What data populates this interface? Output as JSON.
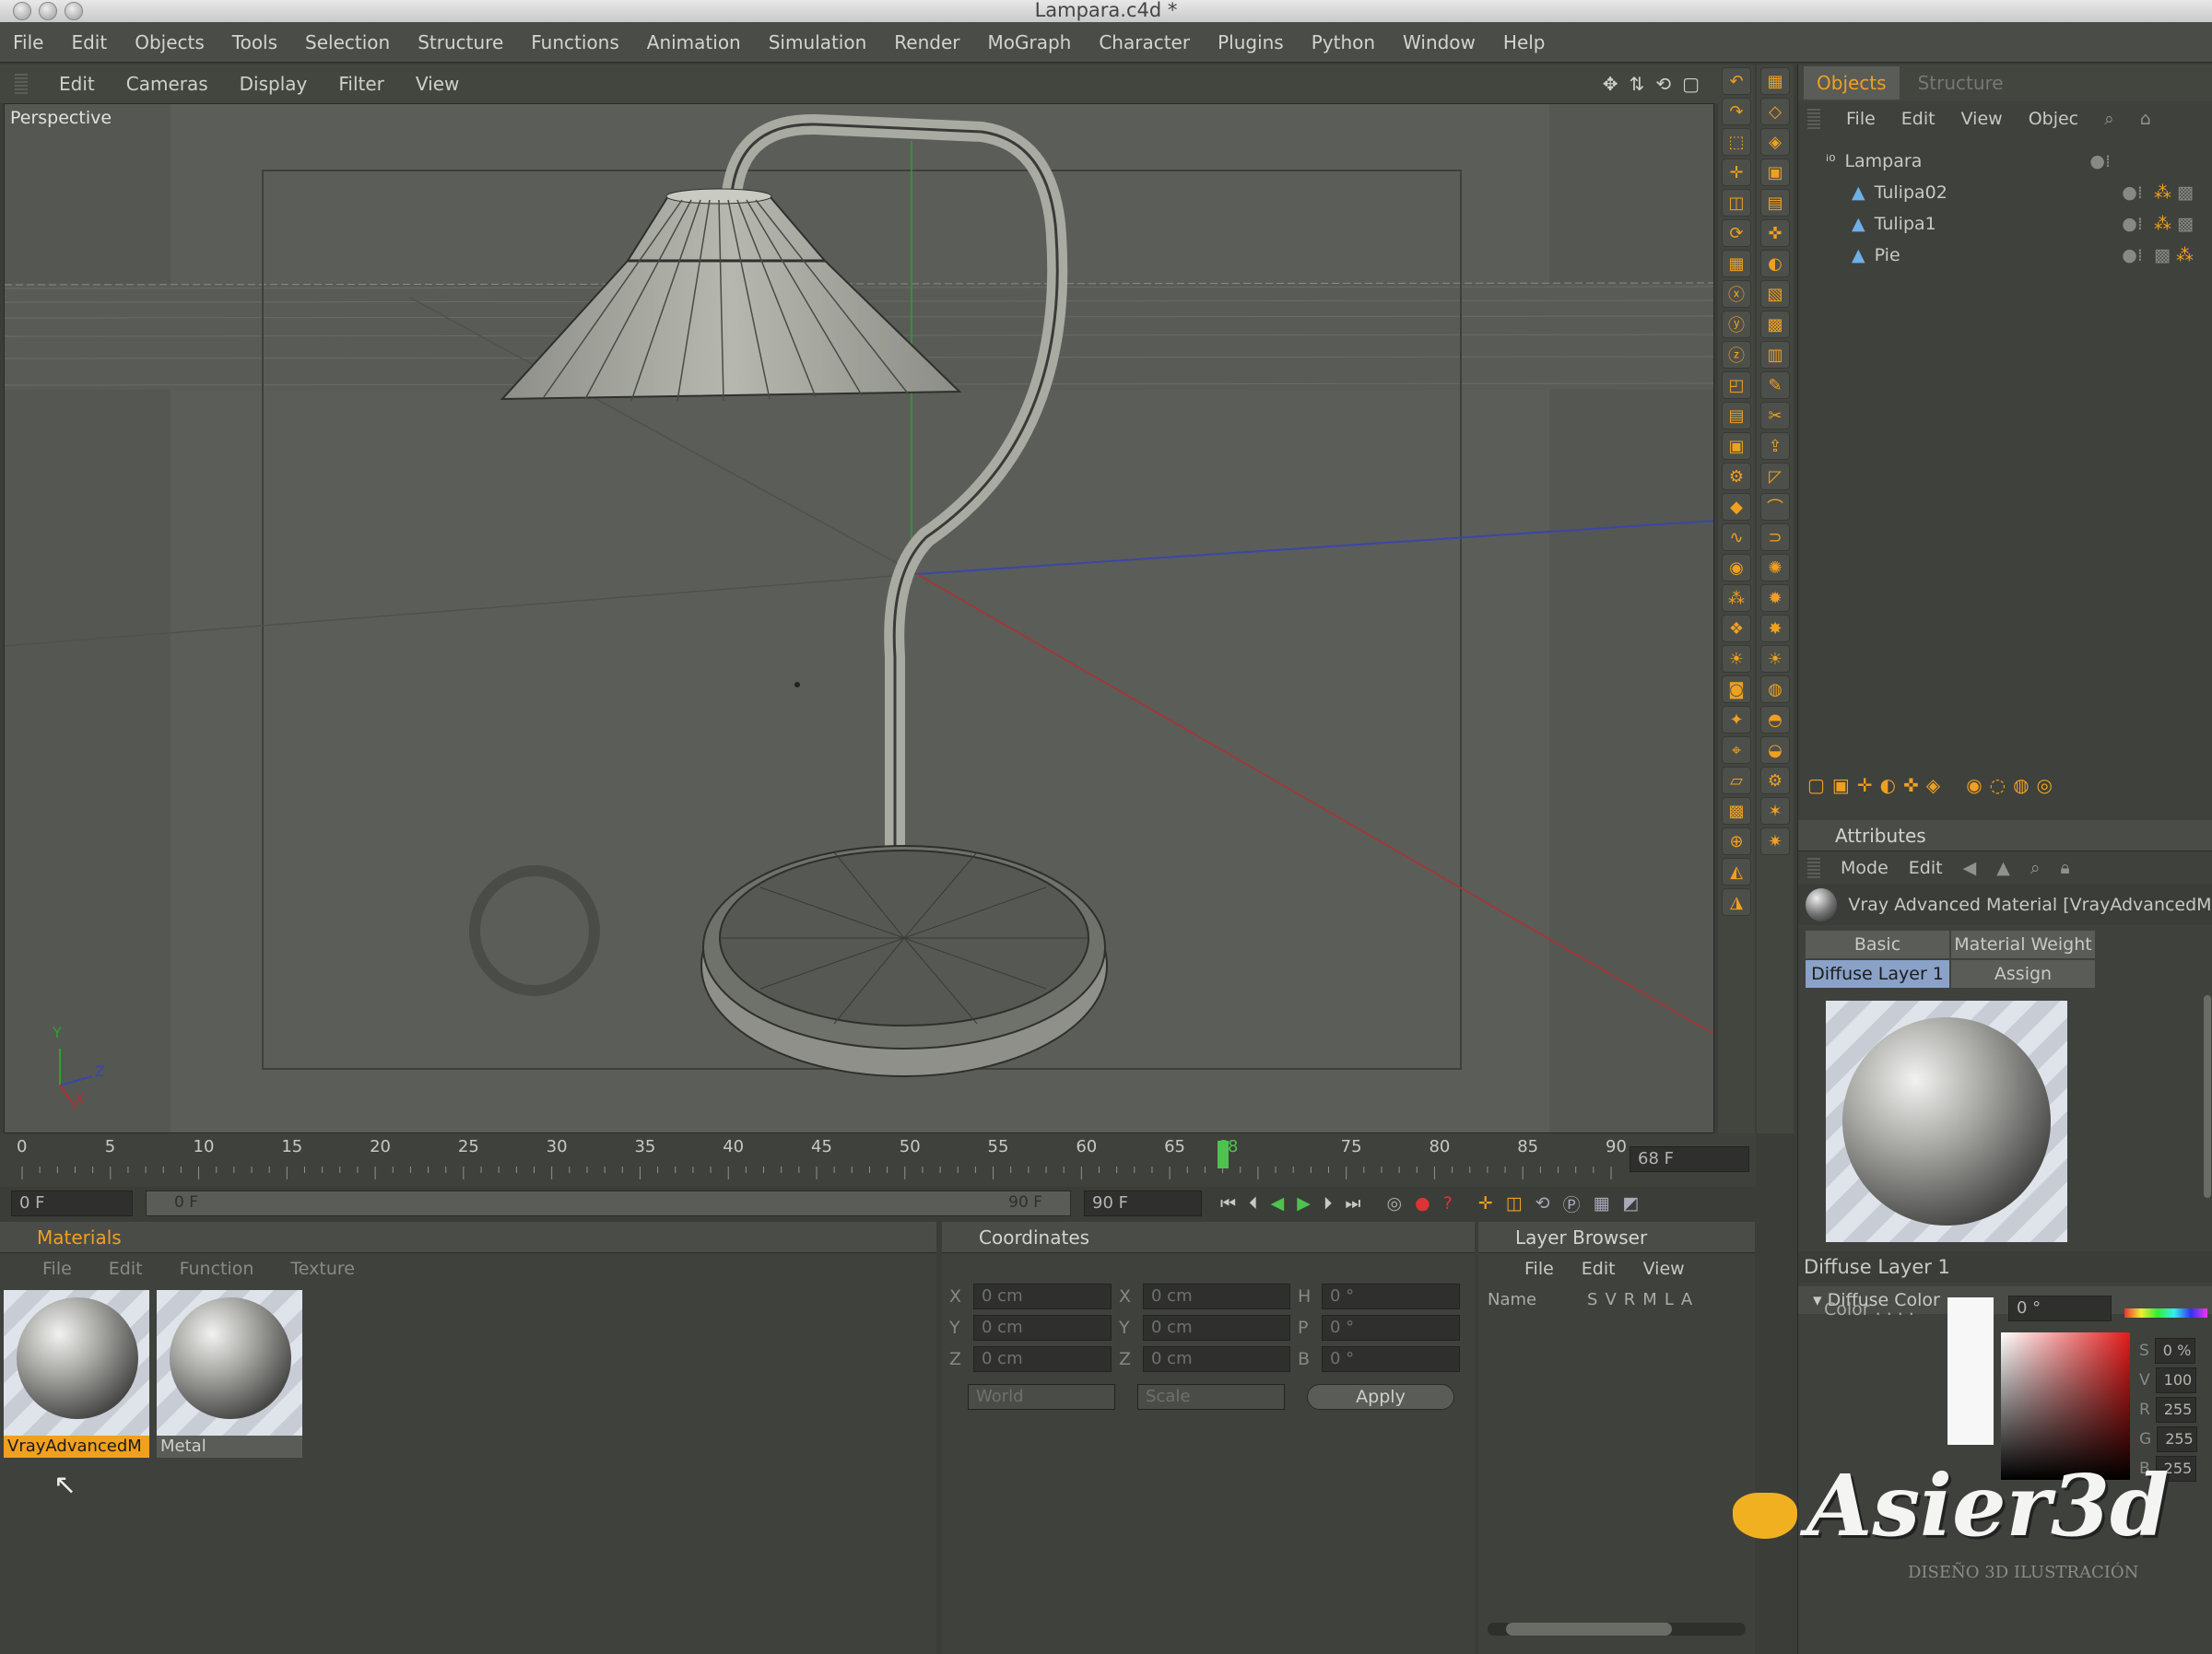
{
  "window": {
    "title": "Lampara.c4d *"
  },
  "menubar": [
    "File",
    "Edit",
    "Objects",
    "Tools",
    "Selection",
    "Structure",
    "Functions",
    "Animation",
    "Simulation",
    "Render",
    "MoGraph",
    "Character",
    "Plugins",
    "Python",
    "Window",
    "Help"
  ],
  "viewport": {
    "menu": [
      "Edit",
      "Cameras",
      "Display",
      "Filter",
      "View"
    ],
    "label": "Perspective",
    "axis": {
      "y": "Y",
      "x": "X",
      "z": "Z"
    }
  },
  "objects_panel": {
    "tabs": [
      "Objects",
      "Structure"
    ],
    "menu": [
      "File",
      "Edit",
      "View",
      "Objec"
    ],
    "tree": [
      {
        "name": "Lampara",
        "depth": 0,
        "icon": "null-object-icon"
      },
      {
        "name": "Tulipa02",
        "depth": 1,
        "icon": "polygon-object-icon"
      },
      {
        "name": "Tulipa1",
        "depth": 1,
        "icon": "polygon-object-icon"
      },
      {
        "name": "Pie",
        "depth": 1,
        "icon": "polygon-object-icon"
      }
    ]
  },
  "attributes": {
    "title": "Attributes",
    "menu": [
      "Mode",
      "Edit"
    ],
    "material_name": "Vray Advanced Material [VrayAdvancedMat",
    "tabs": [
      "Basic",
      "Material Weight",
      "Diffuse Layer 1",
      "Assign"
    ],
    "active_tab": "Diffuse Layer 1",
    "section_title": "Diffuse Layer 1",
    "group": "Diffuse Color",
    "color_label": "Color . . . .",
    "hue_value": "0 °",
    "channels": [
      {
        "label": "S",
        "value": "0 %"
      },
      {
        "label": "V",
        "value": "100"
      },
      {
        "label": "R",
        "value": "255"
      },
      {
        "label": "G",
        "value": "255"
      },
      {
        "label": "B",
        "value": "255"
      }
    ]
  },
  "timeline": {
    "ticks": [
      "0",
      "5",
      "10",
      "15",
      "20",
      "25",
      "30",
      "35",
      "40",
      "45",
      "50",
      "55",
      "60",
      "65",
      "68",
      "75",
      "80",
      "85",
      "90"
    ],
    "current_frame": 68,
    "current_frame_label": "68 F",
    "start_field": "0 F",
    "range_start": "0 F",
    "range_end": "90 F",
    "end_field": "90 F"
  },
  "materials": {
    "title": "Materials",
    "menu": [
      "File",
      "Edit",
      "Function",
      "Texture"
    ],
    "items": [
      {
        "name": "VrayAdvancedM",
        "selected": true
      },
      {
        "name": "Metal",
        "selected": false
      }
    ]
  },
  "coordinates": {
    "title": "Coordinates",
    "rows": [
      {
        "a": "X",
        "a_val": "0 cm",
        "b": "X",
        "b_val": "0 cm",
        "c": "H",
        "c_val": "0 °"
      },
      {
        "a": "Y",
        "a_val": "0 cm",
        "b": "Y",
        "b_val": "0 cm",
        "c": "P",
        "c_val": "0 °"
      },
      {
        "a": "Z",
        "a_val": "0 cm",
        "b": "Z",
        "b_val": "0 cm",
        "c": "B",
        "c_val": "0 °"
      }
    ],
    "mode1": "World",
    "mode2": "Scale",
    "apply": "Apply"
  },
  "layer_browser": {
    "title": "Layer Browser",
    "menu": [
      "File",
      "Edit",
      "View"
    ],
    "columns": [
      "Name",
      "S",
      "V",
      "R",
      "M",
      "L",
      "A"
    ]
  },
  "watermark": {
    "brand": "Asier3d",
    "tagline": "DISEÑO 3D ILUSTRACIÓN"
  },
  "colors": {
    "accent": "#f0a020",
    "background": "#3b3d39",
    "viewport": "#5a5c57"
  }
}
